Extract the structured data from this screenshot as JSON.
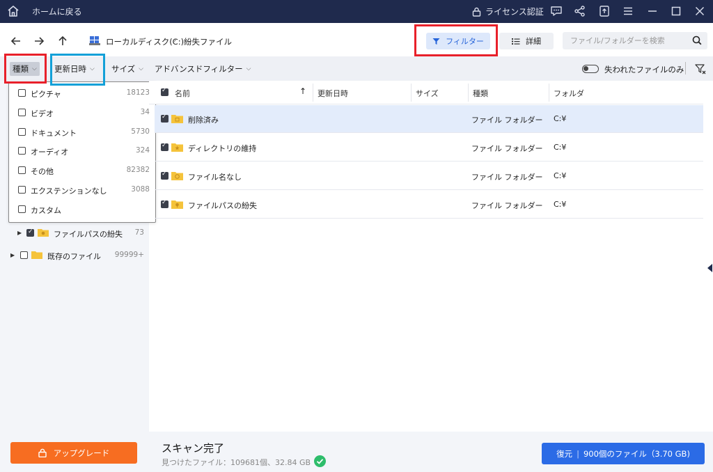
{
  "titlebar": {
    "home_label": "ホームに戻る",
    "license_label": "ライセンス認証",
    "icons": [
      "home-icon",
      "lock-icon",
      "feedback-icon",
      "share-icon",
      "upload-icon",
      "menu-icon",
      "minimize-icon",
      "maximize-icon",
      "close-icon"
    ]
  },
  "nav": {
    "drive": "ローカルディスク(C:)",
    "separator": "›",
    "current": "紛失ファイル"
  },
  "view": {
    "filter_label": "フィルター",
    "detail_label": "詳細",
    "search_placeholder": "ファイル/フォルダーを検索"
  },
  "filterbar": {
    "type_label": "種類",
    "date_label": "更新日時",
    "size_label": "サイズ",
    "advanced_label": "アドバンスドフィルター",
    "lost_only_label": "失われたファイルのみ",
    "lost_only_enabled": false
  },
  "type_dropdown": {
    "items": [
      {
        "label": "ピクチャ",
        "count": "18123"
      },
      {
        "label": "ビデオ",
        "count": "34"
      },
      {
        "label": "ドキュメント",
        "count": "5730"
      },
      {
        "label": "オーディオ",
        "count": "324"
      },
      {
        "label": "その他",
        "count": "82382"
      },
      {
        "label": "エクステンションなし",
        "count": "3088"
      },
      {
        "label": "カスタム",
        "count": ""
      }
    ]
  },
  "tree": {
    "items": [
      {
        "label": "ファイルパスの紛失",
        "count": "73",
        "checked": true
      },
      {
        "label": "既存のファイル",
        "count": "99999+",
        "checked": false
      }
    ]
  },
  "table": {
    "headers": {
      "name": "名前",
      "modified": "更新日時",
      "size": "サイズ",
      "kind": "種類",
      "folder": "フォルダ"
    },
    "rows": [
      {
        "name": "削除済み",
        "kind": "ファイル フォルダー",
        "path": "C:¥",
        "selected": true
      },
      {
        "name": "ディレクトリの維持",
        "kind": "ファイル フォルダー",
        "path": "C:¥",
        "selected": false
      },
      {
        "name": "ファイル名なし",
        "kind": "ファイル フォルダー",
        "path": "C:¥",
        "selected": false
      },
      {
        "name": "ファイルパスの紛失",
        "kind": "ファイル フォルダー",
        "path": "C:¥",
        "selected": false
      }
    ]
  },
  "bottom": {
    "upgrade_label": "アップグレード",
    "scan_title": "スキャン完了",
    "scan_summary": "見つけたファイル：109681個、32.84 GB",
    "recover_label": "復元",
    "recover_detail": "900個のファイル（3.70 GB)"
  },
  "colors": {
    "titlebar_bg": "#1f2a4d",
    "accent": "#2b6be6",
    "upgrade": "#f76d21",
    "highlight_red": "#e8202a",
    "highlight_blue": "#13a0d8",
    "selected_row": "#e3ecfb",
    "success": "#2ebd6b"
  }
}
